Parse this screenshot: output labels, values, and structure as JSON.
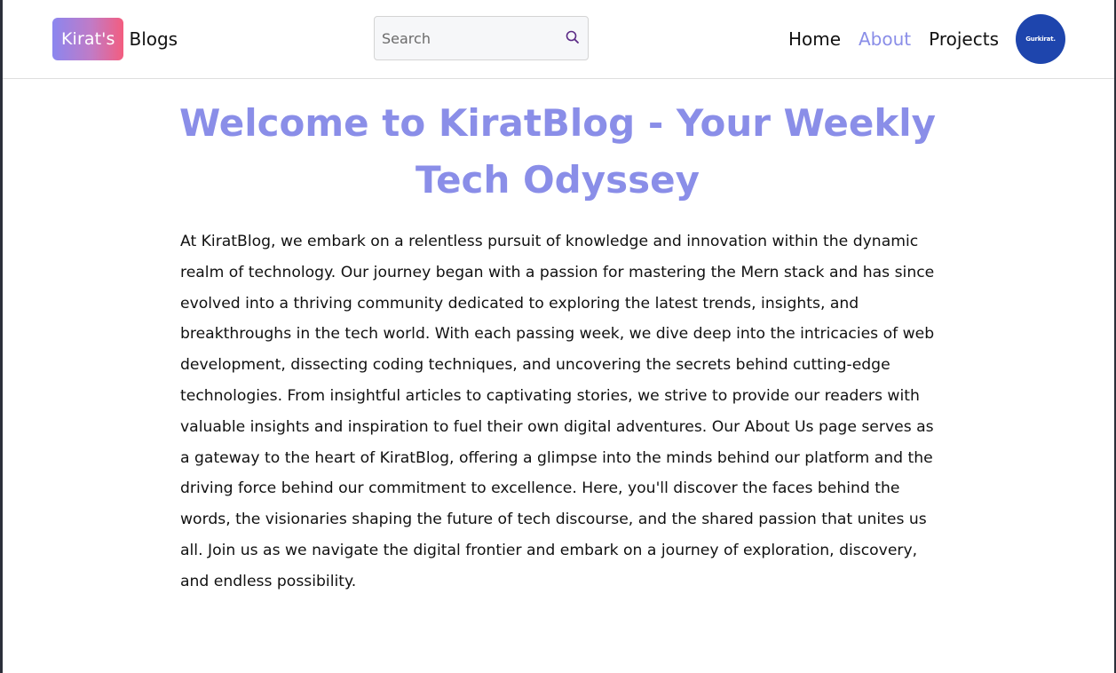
{
  "brand": {
    "badge": "Kirat's",
    "text": "Blogs"
  },
  "search": {
    "placeholder": "Search",
    "value": "",
    "icon": "search-icon"
  },
  "nav": {
    "items": [
      {
        "label": "Home",
        "active": false
      },
      {
        "label": "About",
        "active": true
      },
      {
        "label": "Projects",
        "active": false
      }
    ]
  },
  "avatar": {
    "text": "Gurkirat."
  },
  "main": {
    "title": "Welcome to KiratBlog - Your Weekly Tech Odyssey",
    "body": "At KiratBlog, we embark on a relentless pursuit of knowledge and innovation within the dynamic realm of technology. Our journey began with a passion for mastering the Mern stack and has since evolved into a thriving community dedicated to exploring the latest trends, insights, and breakthroughs in the tech world. With each passing week, we dive deep into the intricacies of web development, dissecting coding techniques, and uncovering the secrets behind cutting-edge technologies. From insightful articles to captivating stories, we strive to provide our readers with valuable insights and inspiration to fuel their own digital adventures. Our About Us page serves as a gateway to the heart of KiratBlog, offering a glimpse into the minds behind our platform and the driving force behind our commitment to excellence. Here, you'll discover the faces behind the words, the visionaries shaping the future of tech discourse, and the shared passion that unites us all. Join us as we navigate the digital frontier and embark on a journey of exploration, discovery, and endless possibility."
  },
  "colors": {
    "accent": "#8a8ee8",
    "avatar_bg": "#1e45ad",
    "brand_gradient_start": "#8b86ef",
    "brand_gradient_end": "#f35d7f"
  }
}
